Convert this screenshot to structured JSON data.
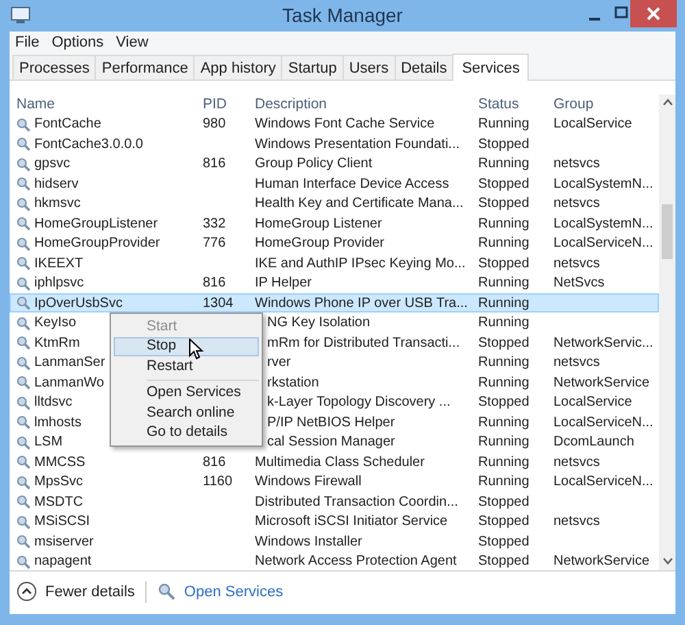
{
  "window": {
    "title": "Task Manager"
  },
  "menu_bar": [
    "File",
    "Options",
    "View"
  ],
  "tabs": [
    {
      "label": "Processes",
      "selected": false
    },
    {
      "label": "Performance",
      "selected": false
    },
    {
      "label": "App history",
      "selected": false
    },
    {
      "label": "Startup",
      "selected": false
    },
    {
      "label": "Users",
      "selected": false
    },
    {
      "label": "Details",
      "selected": false
    },
    {
      "label": "Services",
      "selected": true
    }
  ],
  "table": {
    "columns": [
      "Name",
      "PID",
      "Description",
      "Status",
      "Group"
    ],
    "rows": [
      {
        "name": "FontCache",
        "pid": "980",
        "description": "Windows Font Cache Service",
        "status": "Running",
        "group": "LocalService",
        "selected": false
      },
      {
        "name": "FontCache3.0.0.0",
        "description": "Windows Presentation Foundati...",
        "status": "Stopped",
        "selected": false
      },
      {
        "name": "gpsvc",
        "pid": "816",
        "description": "Group Policy Client",
        "status": "Running",
        "group": "netsvcs",
        "selected": false
      },
      {
        "name": "hidserv",
        "description": "Human Interface Device Access",
        "status": "Stopped",
        "group": "LocalSystemN...",
        "selected": false
      },
      {
        "name": "hkmsvc",
        "description": "Health Key and Certificate Mana...",
        "status": "Stopped",
        "group": "netsvcs",
        "selected": false
      },
      {
        "name": "HomeGroupListener",
        "pid": "332",
        "description": "HomeGroup Listener",
        "status": "Running",
        "group": "LocalSystemN...",
        "selected": false
      },
      {
        "name": "HomeGroupProvider",
        "pid": "776",
        "description": "HomeGroup Provider",
        "status": "Running",
        "group": "LocalServiceN...",
        "selected": false
      },
      {
        "name": "IKEEXT",
        "description": "IKE and AuthIP IPsec Keying Mo...",
        "status": "Stopped",
        "group": "netsvcs",
        "selected": false
      },
      {
        "name": "iphlpsvc",
        "pid": "816",
        "description": "IP Helper",
        "status": "Running",
        "group": "NetSvcs",
        "selected": false
      },
      {
        "name": "IpOverUsbSvc",
        "pid": "1304",
        "description": "Windows Phone IP over USB Tra...",
        "status": "Running",
        "selected": true
      },
      {
        "name": "KeyIso",
        "description": "NG Key Isolation",
        "status": "Running",
        "selected": false
      },
      {
        "name": "KtmRm",
        "description": "mRm for Distributed Transacti...",
        "status": "Stopped",
        "group": "NetworkServic...",
        "selected": false
      },
      {
        "name": "LanmanSer",
        "description": "rver",
        "status": "Running",
        "group": "netsvcs",
        "selected": false
      },
      {
        "name": "LanmanWo",
        "description": "rkstation",
        "status": "Running",
        "group": "NetworkService",
        "selected": false
      },
      {
        "name": "lltdsvc",
        "description": "k-Layer Topology Discovery ...",
        "status": "Stopped",
        "group": "LocalService",
        "selected": false
      },
      {
        "name": "lmhosts",
        "description": "P/IP NetBIOS Helper",
        "status": "Running",
        "group": "LocalServiceN...",
        "selected": false
      },
      {
        "name": "LSM",
        "description": "cal Session Manager",
        "status": "Running",
        "group": "DcomLaunch",
        "selected": false
      },
      {
        "name": "MMCSS",
        "pid": "816",
        "description": "Multimedia Class Scheduler",
        "status": "Running",
        "group": "netsvcs",
        "selected": false
      },
      {
        "name": "MpsSvc",
        "pid": "1160",
        "description": "Windows Firewall",
        "status": "Running",
        "group": "LocalServiceN...",
        "selected": false
      },
      {
        "name": "MSDTC",
        "description": "Distributed Transaction Coordin...",
        "status": "Stopped",
        "selected": false
      },
      {
        "name": "MSiSCSI",
        "description": "Microsoft iSCSI Initiator Service",
        "status": "Stopped",
        "group": "netsvcs",
        "selected": false
      },
      {
        "name": "msiserver",
        "description": "Windows Installer",
        "status": "Stopped",
        "selected": false
      },
      {
        "name": "napagent",
        "description": "Network Access Protection Agent",
        "status": "Stopped",
        "group": "NetworkService",
        "selected": false
      }
    ]
  },
  "context_menu": {
    "items": [
      {
        "kind": "item",
        "label": "Start",
        "disabled": true,
        "selected": false
      },
      {
        "kind": "item",
        "label": "Stop",
        "disabled": false,
        "selected": true
      },
      {
        "kind": "item",
        "label": "Restart",
        "disabled": false,
        "selected": false
      },
      {
        "kind": "separator"
      },
      {
        "kind": "item",
        "label": "Open Services",
        "disabled": false,
        "selected": false
      },
      {
        "kind": "item",
        "label": "Search online",
        "disabled": false,
        "selected": false
      },
      {
        "kind": "item",
        "label": "Go to details",
        "disabled": false,
        "selected": false
      }
    ]
  },
  "footer": {
    "toggle": "Fewer details",
    "link": "Open Services"
  }
}
